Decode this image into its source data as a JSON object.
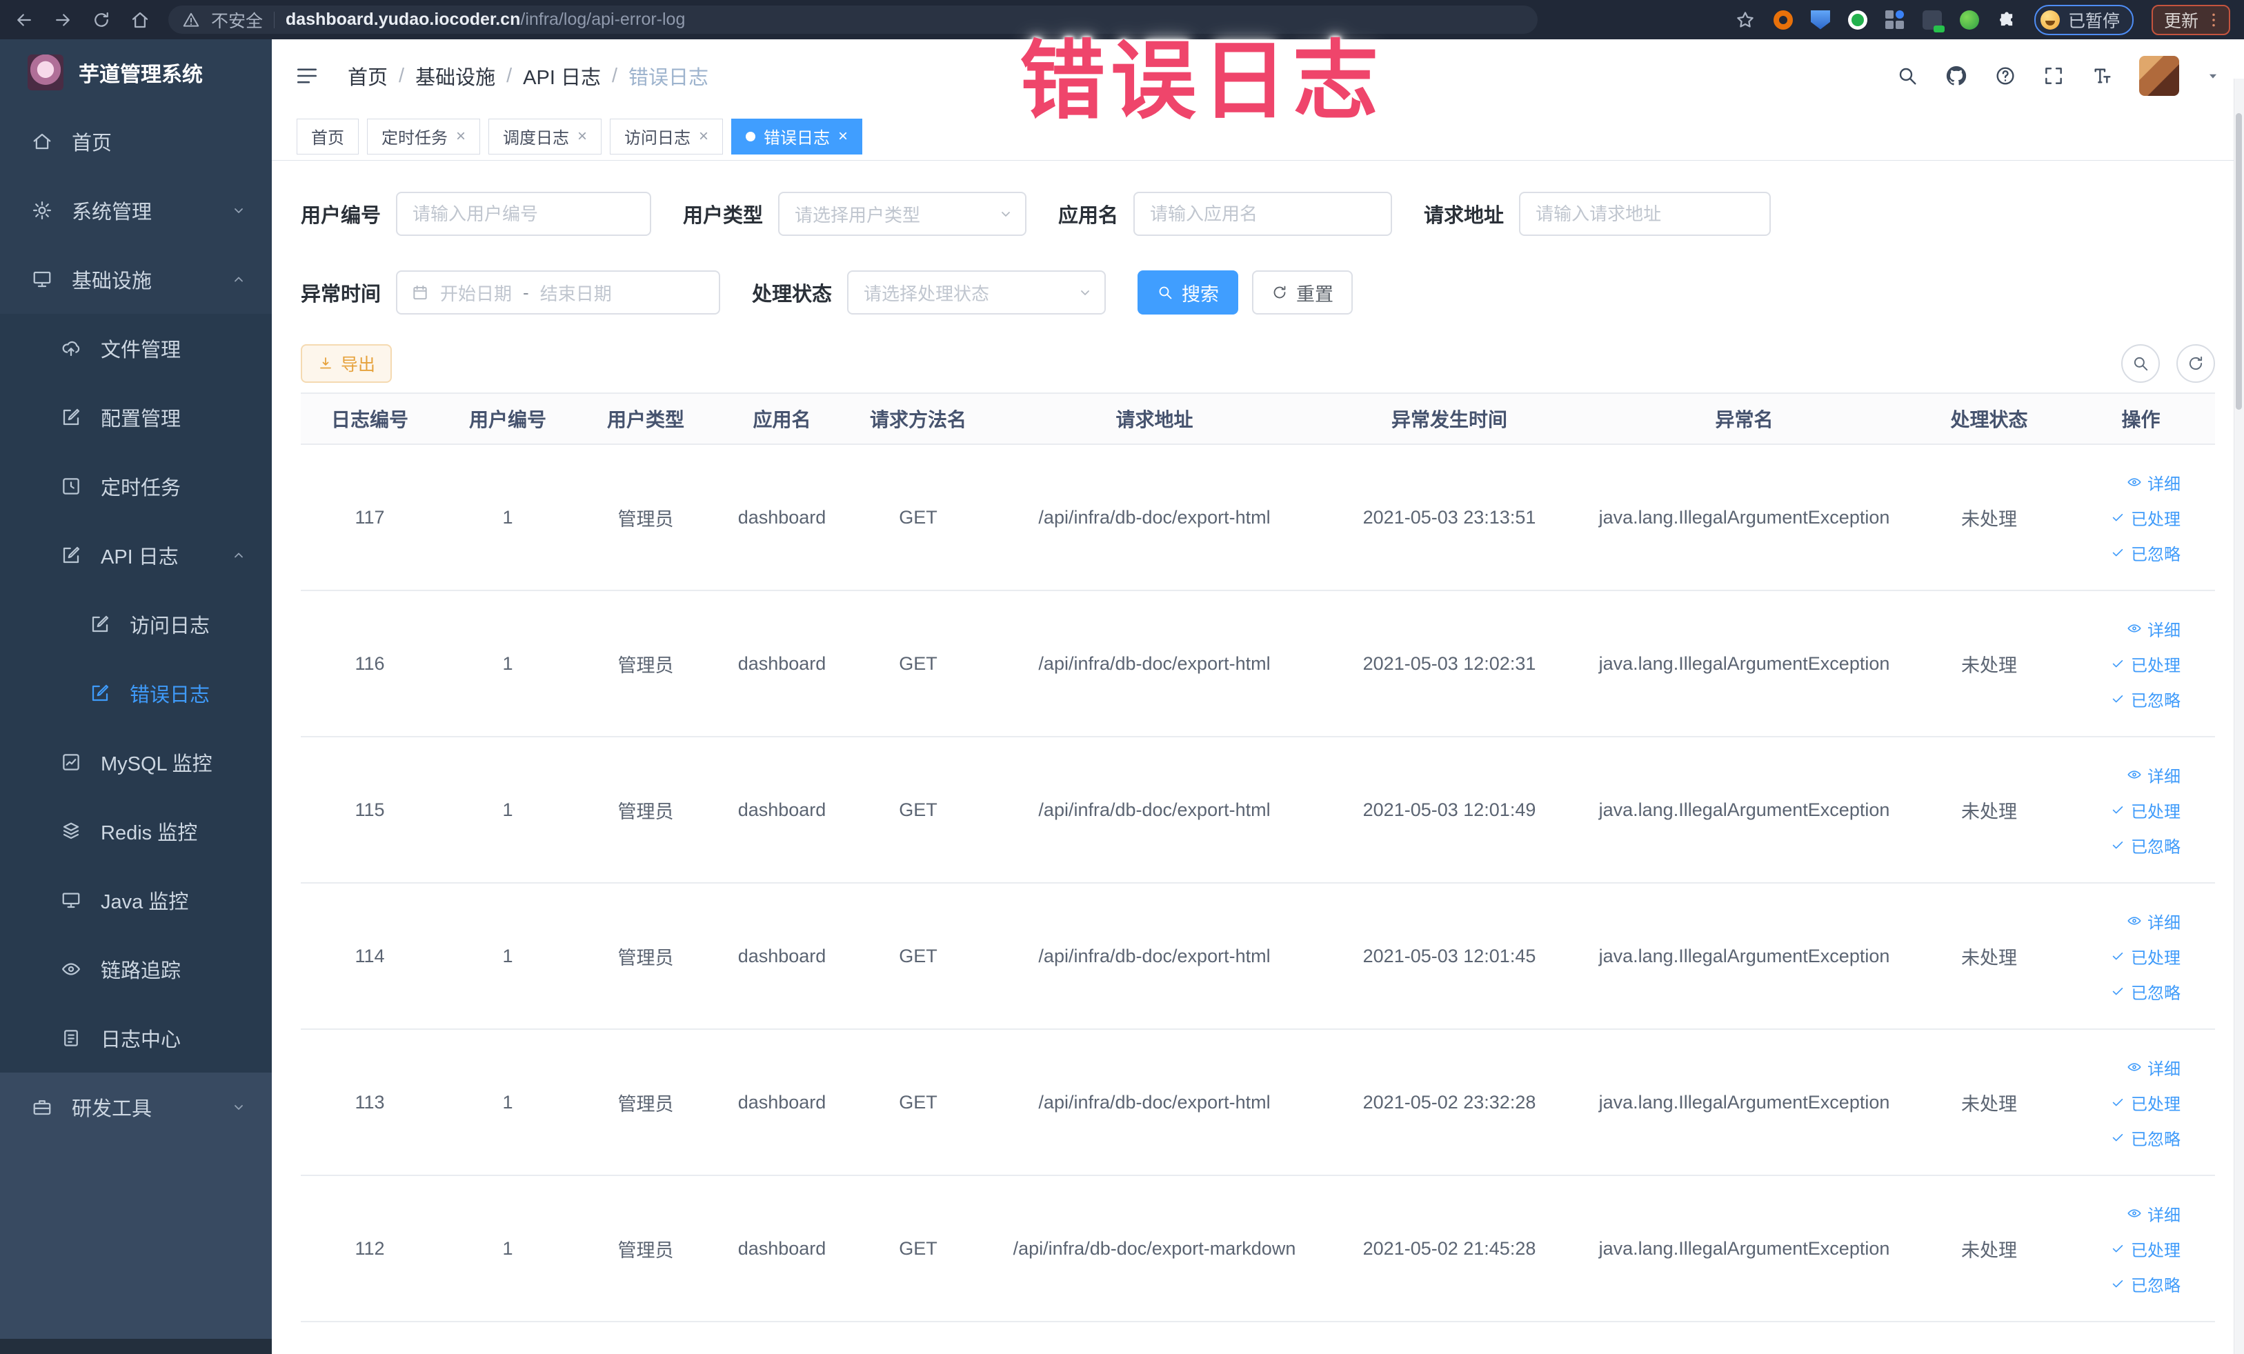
{
  "overlay": {
    "text": "错误日志"
  },
  "browser": {
    "security_label": "不安全",
    "url_host": "dashboard.yudao.iocoder.cn",
    "url_path": "/infra/log/api-error-log",
    "paused_label": "已暂停",
    "update_label": "更新"
  },
  "sidebar": {
    "title": "芋道管理系统",
    "items": [
      {
        "key": "home",
        "label": "首页",
        "icon": "home-icon",
        "level": 1
      },
      {
        "key": "system",
        "label": "系统管理",
        "icon": "gear-icon",
        "level": 1,
        "chevron": "down"
      },
      {
        "key": "infra",
        "label": "基础设施",
        "icon": "infra-icon",
        "level": 1,
        "chevron": "up"
      },
      {
        "key": "file",
        "label": "文件管理",
        "icon": "file-icon",
        "level": 2,
        "group": "infra"
      },
      {
        "key": "config",
        "label": "配置管理",
        "icon": "config-icon",
        "level": 2,
        "group": "infra"
      },
      {
        "key": "job",
        "label": "定时任务",
        "icon": "job-icon",
        "level": 2,
        "group": "infra"
      },
      {
        "key": "api-log",
        "label": "API 日志",
        "icon": "apilog-icon",
        "level": 2,
        "chevron": "up",
        "group": "infra"
      },
      {
        "key": "access-log",
        "label": "访问日志",
        "icon": "accesslog-icon",
        "level": 3,
        "group": "infra"
      },
      {
        "key": "error-log",
        "label": "错误日志",
        "icon": "errorlog-icon",
        "level": 3,
        "group": "infra",
        "active": true
      },
      {
        "key": "mysql",
        "label": "MySQL 监控",
        "icon": "mysql-icon",
        "level": 2,
        "group": "infra"
      },
      {
        "key": "redis",
        "label": "Redis 监控",
        "icon": "redis-icon",
        "level": 2,
        "group": "infra"
      },
      {
        "key": "java",
        "label": "Java 监控",
        "icon": "java-icon",
        "level": 2,
        "group": "infra"
      },
      {
        "key": "trace",
        "label": "链路追踪",
        "icon": "trace-icon",
        "level": 2,
        "group": "infra"
      },
      {
        "key": "log-center",
        "label": "日志中心",
        "icon": "logcenter-icon",
        "level": 2,
        "group": "infra"
      },
      {
        "key": "dev-tools",
        "label": "研发工具",
        "icon": "tools-icon",
        "level": 1,
        "chevron": "down",
        "section": "light"
      }
    ]
  },
  "header": {
    "breadcrumb": [
      {
        "label": "首页"
      },
      {
        "label": "基础设施"
      },
      {
        "label": "API 日志"
      },
      {
        "label": "错误日志",
        "current": true
      }
    ]
  },
  "tabs": [
    {
      "key": "home",
      "label": "首页",
      "closable": false,
      "active": false
    },
    {
      "key": "job",
      "label": "定时任务",
      "closable": true,
      "active": false
    },
    {
      "key": "job-log",
      "label": "调度日志",
      "closable": true,
      "active": false
    },
    {
      "key": "access-log",
      "label": "访问日志",
      "closable": true,
      "active": false
    },
    {
      "key": "error-log",
      "label": "错误日志",
      "closable": true,
      "active": true
    }
  ],
  "filters": {
    "user_id": {
      "label": "用户编号",
      "placeholder": "请输入用户编号"
    },
    "user_type": {
      "label": "用户类型",
      "placeholder": "请选择用户类型"
    },
    "app_name": {
      "label": "应用名",
      "placeholder": "请输入应用名"
    },
    "request_url": {
      "label": "请求地址",
      "placeholder": "请输入请求地址"
    },
    "exception_time": {
      "label": "异常时间",
      "start_placeholder": "开始日期",
      "separator": "-",
      "end_placeholder": "结束日期"
    },
    "process_status": {
      "label": "处理状态",
      "placeholder": "请选择处理状态"
    },
    "search_label": "搜索",
    "reset_label": "重置"
  },
  "toolbar": {
    "export_label": "导出"
  },
  "table": {
    "columns": [
      "日志编号",
      "用户编号",
      "用户类型",
      "应用名",
      "请求方法名",
      "请求地址",
      "异常发生时间",
      "异常名",
      "处理状态",
      "操作"
    ],
    "actions": [
      "详细",
      "已处理",
      "已忽略"
    ],
    "rows": [
      {
        "id": "117",
        "user_id": "1",
        "user_type": "管理员",
        "app": "dashboard",
        "method": "GET",
        "url": "/api/infra/db-doc/export-html",
        "time": "2021-05-03 23:13:51",
        "exception": "java.lang.IllegalArgumentException",
        "status": "未处理"
      },
      {
        "id": "116",
        "user_id": "1",
        "user_type": "管理员",
        "app": "dashboard",
        "method": "GET",
        "url": "/api/infra/db-doc/export-html",
        "time": "2021-05-03 12:02:31",
        "exception": "java.lang.IllegalArgumentException",
        "status": "未处理"
      },
      {
        "id": "115",
        "user_id": "1",
        "user_type": "管理员",
        "app": "dashboard",
        "method": "GET",
        "url": "/api/infra/db-doc/export-html",
        "time": "2021-05-03 12:01:49",
        "exception": "java.lang.IllegalArgumentException",
        "status": "未处理"
      },
      {
        "id": "114",
        "user_id": "1",
        "user_type": "管理员",
        "app": "dashboard",
        "method": "GET",
        "url": "/api/infra/db-doc/export-html",
        "time": "2021-05-03 12:01:45",
        "exception": "java.lang.IllegalArgumentException",
        "status": "未处理"
      },
      {
        "id": "113",
        "user_id": "1",
        "user_type": "管理员",
        "app": "dashboard",
        "method": "GET",
        "url": "/api/infra/db-doc/export-html",
        "time": "2021-05-02 23:32:28",
        "exception": "java.lang.IllegalArgumentException",
        "status": "未处理"
      },
      {
        "id": "112",
        "user_id": "1",
        "user_type": "管理员",
        "app": "dashboard",
        "method": "GET",
        "url": "/api/infra/db-doc/export-markdown",
        "time": "2021-05-02 21:45:28",
        "exception": "java.lang.IllegalArgumentException",
        "status": "未处理"
      }
    ]
  },
  "colors": {
    "accent": "#409eff",
    "warning": "#e6a23c",
    "overlay_text": "#ef456b",
    "sidebar_bg": "#2d3f54"
  }
}
